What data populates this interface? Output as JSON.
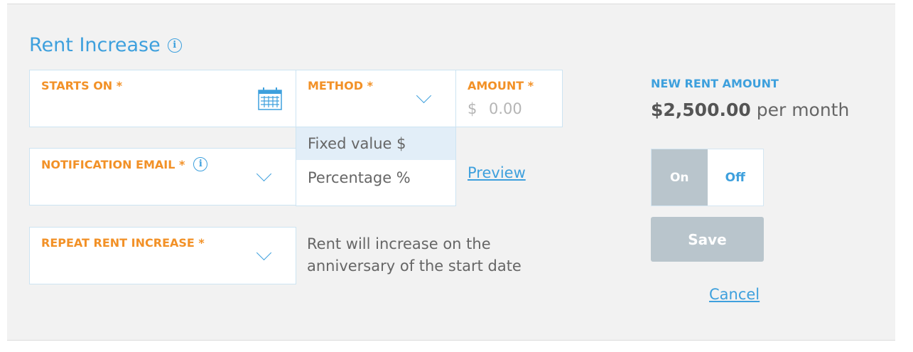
{
  "section": {
    "title": "Rent Increase"
  },
  "fields": {
    "starts_on": {
      "label": "STARTS ON *"
    },
    "method": {
      "label": "METHOD *"
    },
    "amount": {
      "label": "AMOUNT *",
      "currency": "$",
      "placeholder": "0.00"
    },
    "notification_email": {
      "label": "NOTIFICATION EMAIL *"
    },
    "repeat_rent_increase": {
      "label": "REPEAT RENT INCREASE *"
    }
  },
  "method_dropdown": {
    "options": [
      "Fixed value $",
      "Percentage %"
    ],
    "selected_index": 0
  },
  "preview_link": "Preview",
  "repeat_note": {
    "line1": "Rent will increase on the",
    "line2": "anniversary of the start date"
  },
  "new_rent": {
    "label": "NEW RENT AMOUNT",
    "value": "$2,500.00",
    "period": "per month"
  },
  "toggle": {
    "on_label": "On",
    "off_label": "Off",
    "active": "On"
  },
  "actions": {
    "save_label": "Save",
    "cancel_label": "Cancel"
  },
  "colors": {
    "accent_blue": "#3ea0dd",
    "label_orange": "#f29127",
    "disabled_gray": "#b9c5cc"
  }
}
